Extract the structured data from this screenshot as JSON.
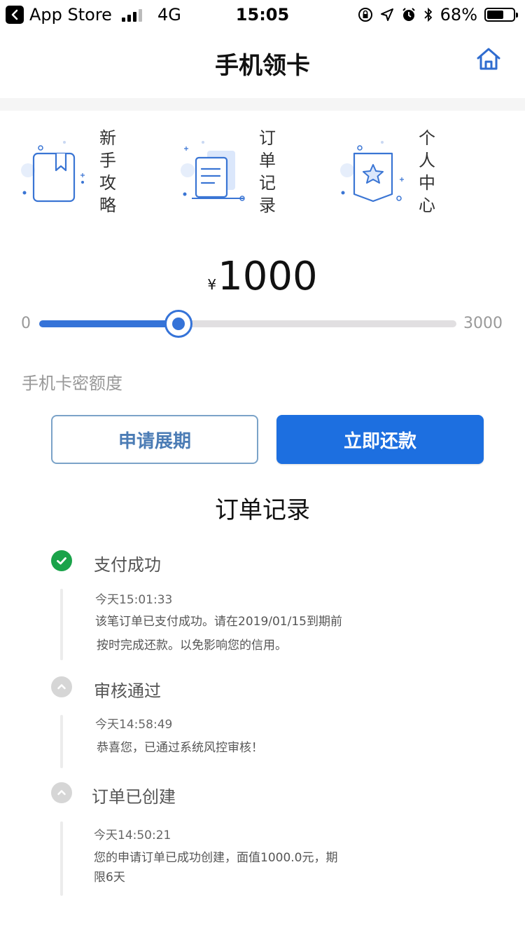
{
  "status_bar": {
    "carrier_back": "App Store",
    "network": "4G",
    "time": "15:05",
    "battery_percent": "68%",
    "battery_level": 0.68
  },
  "nav": {
    "title": "手机领卡",
    "home_icon": "home-icon"
  },
  "quick_menu": [
    {
      "label": "新手攻略",
      "icon": "bookmark-book-icon"
    },
    {
      "label": "订单记录",
      "icon": "document-stack-icon"
    },
    {
      "label": "个人中心",
      "icon": "star-badge-icon"
    }
  ],
  "amount": {
    "currency": "¥",
    "value": "1000"
  },
  "slider": {
    "min_label": "0",
    "max_label": "3000",
    "min": 0,
    "max": 3000,
    "value": 1000
  },
  "limit_label": "手机卡密额度",
  "buttons": {
    "extend": "申请展期",
    "repay": "立即还款"
  },
  "section_title": "订单记录",
  "timeline": [
    {
      "title": "支付成功",
      "time": "今天15:01:33",
      "desc_lines": [
        "该笔订单已支付成功。请在2019/01/15到期前",
        "按时完成还款。以免影响您的信用。"
      ],
      "status": "success"
    },
    {
      "title": "审核通过",
      "time": "今天14:58:49",
      "desc_lines": [
        "恭喜您，已通过系统风控审核！"
      ],
      "status": "done"
    },
    {
      "title": "订单已创建",
      "time": "今天14:50:21",
      "desc_lines": [
        "您的申请订单已成功创建，面值1000.0元，期",
        "限6天"
      ],
      "status": "done"
    }
  ],
  "colors": {
    "accent": "#1d6fe0",
    "slider": "#3573d8",
    "success": "#1aa34a"
  }
}
